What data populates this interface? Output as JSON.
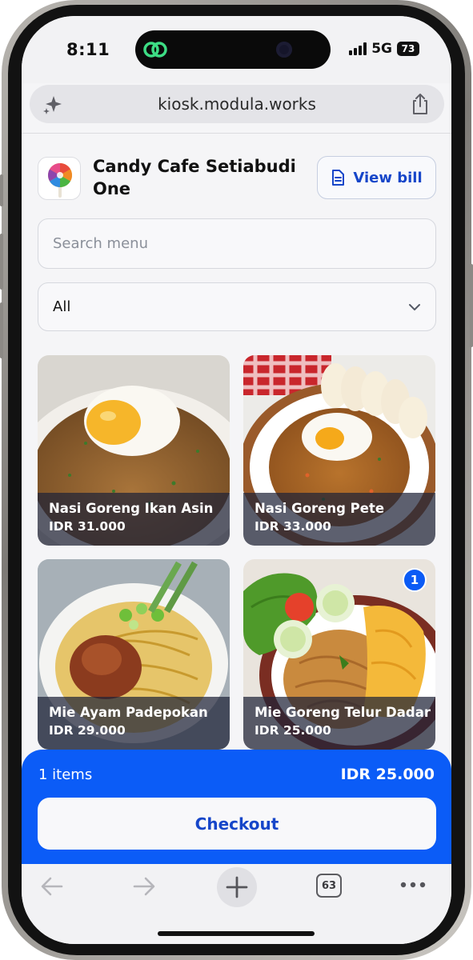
{
  "status_bar": {
    "time": "8:11",
    "network": "5G",
    "battery": "73"
  },
  "browser": {
    "url": "kiosk.modula.works",
    "tab_count": "63",
    "icons": [
      "sparkle-icon",
      "share-icon",
      "back-icon",
      "forward-icon",
      "plus-icon",
      "tabs-icon",
      "more-icon"
    ]
  },
  "header": {
    "cafe_name": "Candy Cafe Setiabudi One",
    "view_bill_label": "View bill"
  },
  "search": {
    "placeholder": "Search menu"
  },
  "category_filter": {
    "selected": "All"
  },
  "menu_items": [
    {
      "name": "Nasi Goreng Ikan Asin",
      "price": "IDR 31.000",
      "in_cart": ""
    },
    {
      "name": "Nasi Goreng Pete",
      "price": "IDR 33.000",
      "in_cart": ""
    },
    {
      "name": "Mie Ayam Padepokan",
      "price": "IDR 29.000",
      "in_cart": ""
    },
    {
      "name": "Mie Goreng Telur Dadar",
      "price": "IDR 25.000",
      "in_cart": "1"
    }
  ],
  "cart": {
    "items_label": "1 items",
    "total": "IDR 25.000",
    "checkout_label": "Checkout"
  },
  "colors": {
    "accent": "#0b5cf7",
    "link": "#1646c9",
    "caption_overlay": "#1e2238"
  }
}
